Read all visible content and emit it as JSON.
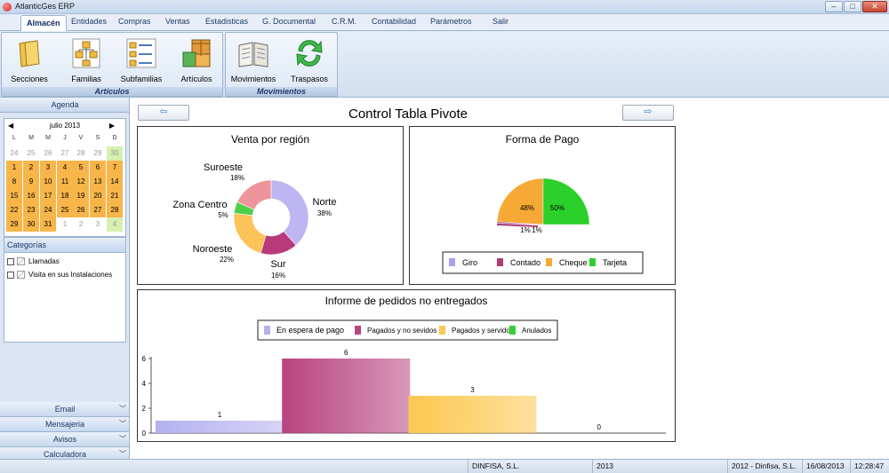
{
  "window": {
    "title": "AtlanticGes ERP"
  },
  "menu": {
    "tabs": [
      "Almacén",
      "Entidades",
      "Compras",
      "Ventas",
      "Estadisticas",
      "G. Documental",
      "C.R.M.",
      "Contabilidad",
      "Parámetros",
      "Salir"
    ]
  },
  "ribbon": {
    "articulos": {
      "caption": "Artículos",
      "buttons": [
        "Secciones",
        "Familias",
        "Subfamilias",
        "Artículos"
      ]
    },
    "movimientos": {
      "caption": "Movimientos",
      "buttons": [
        "Movimientos",
        "Traspasos"
      ]
    }
  },
  "sidebar": {
    "agenda": "Agenda",
    "calendar": {
      "month": "julio 2013",
      "prev": "◀",
      "next": "▶",
      "dow": [
        "L",
        "M",
        "M",
        "J",
        "V",
        "S",
        "D"
      ],
      "weeks": [
        [
          "24",
          "25",
          "26",
          "27",
          "28",
          "29",
          "30"
        ],
        [
          "1",
          "2",
          "3",
          "4",
          "5",
          "6",
          "7"
        ],
        [
          "8",
          "9",
          "10",
          "11",
          "12",
          "13",
          "14"
        ],
        [
          "15",
          "16",
          "17",
          "18",
          "19",
          "20",
          "21"
        ],
        [
          "22",
          "23",
          "24",
          "25",
          "26",
          "27",
          "28"
        ],
        [
          "29",
          "30",
          "31",
          "1",
          "2",
          "3",
          "4"
        ]
      ]
    },
    "categorias": {
      "title": "Categorías",
      "items": [
        "Llamadas",
        "Visita en sus Instalaciones"
      ]
    },
    "sections": [
      "Email",
      "Mensajeria",
      "Avisos",
      "Calculadora"
    ]
  },
  "main": {
    "title": "Control Tabla Pivote",
    "prev_arrow": "⇦",
    "next_arrow": "⇨",
    "region_chart": {
      "title": "Venta por región"
    },
    "pago_chart": {
      "title": "Forma de Pago"
    },
    "pedidos_chart": {
      "title": "Informe de pedidos no entregados"
    }
  },
  "chart_data": [
    {
      "type": "pie",
      "title": "Venta por región",
      "labels": [
        "Norte",
        "Sur",
        "Noroeste",
        "Zona Centro",
        "Suroeste"
      ],
      "values": [
        38,
        16,
        22,
        5,
        18
      ],
      "value_labels": [
        "38%",
        "16%",
        "22%",
        "5%",
        "18%"
      ],
      "colors": [
        "#bdb6f2",
        "#b83a7a",
        "#fcc35a",
        "#4cd04c",
        "#f0949c"
      ],
      "donut": true
    },
    {
      "type": "pie",
      "title": "Forma de Pago",
      "labels": [
        "Giro",
        "Contado",
        "Cheque",
        "Tarjeta"
      ],
      "values": [
        1,
        1,
        48,
        50
      ],
      "value_labels": [
        "1%",
        "1%",
        "48%",
        "50%"
      ],
      "colors": [
        "#a9a2ee",
        "#b03b75",
        "#f7a935",
        "#2bd02b"
      ],
      "half_pie": true,
      "legend": "bottom"
    },
    {
      "type": "bar",
      "title": "Informe de pedidos no entregados",
      "series": [
        {
          "name": "En espera de pago",
          "values": [
            1
          ]
        },
        {
          "name": "Pagados y no sevidos",
          "values": [
            6
          ]
        },
        {
          "name": "Pagados y servidos",
          "values": [
            3
          ]
        },
        {
          "name": "Anulados",
          "values": [
            0
          ]
        }
      ],
      "colors": [
        "#b4b0f0",
        "#b8437f",
        "#fcc84f",
        "#36d036"
      ],
      "value_labels": [
        "1",
        "6",
        "3",
        "0"
      ],
      "ylim": [
        0,
        6
      ],
      "yticks": [
        "0",
        "2",
        "4",
        "6"
      ],
      "legend": "top"
    }
  ],
  "status": {
    "company": "DINFISA, S.L.",
    "year": "2013",
    "exercise": "2012 - Dinfisa, S.L.",
    "date": "16/08/2013",
    "time": "12:28:47"
  }
}
